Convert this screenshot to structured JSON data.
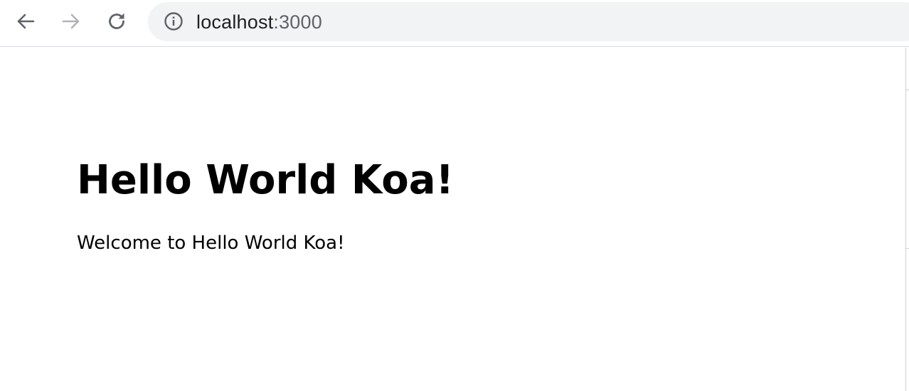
{
  "browser": {
    "back_icon": "arrow-left-icon",
    "forward_icon": "arrow-right-icon",
    "reload_icon": "reload-icon",
    "site_info_icon": "info-icon",
    "url_host": "localhost",
    "url_port": ":3000",
    "colors": {
      "toolbar_bg": "#ffffff",
      "omnibox_bg": "#f1f3f4",
      "icon_active": "#5f6368",
      "icon_disabled": "#b0b3b8"
    }
  },
  "page": {
    "heading": "Hello World Koa!",
    "paragraph": "Welcome to Hello World Koa!"
  }
}
